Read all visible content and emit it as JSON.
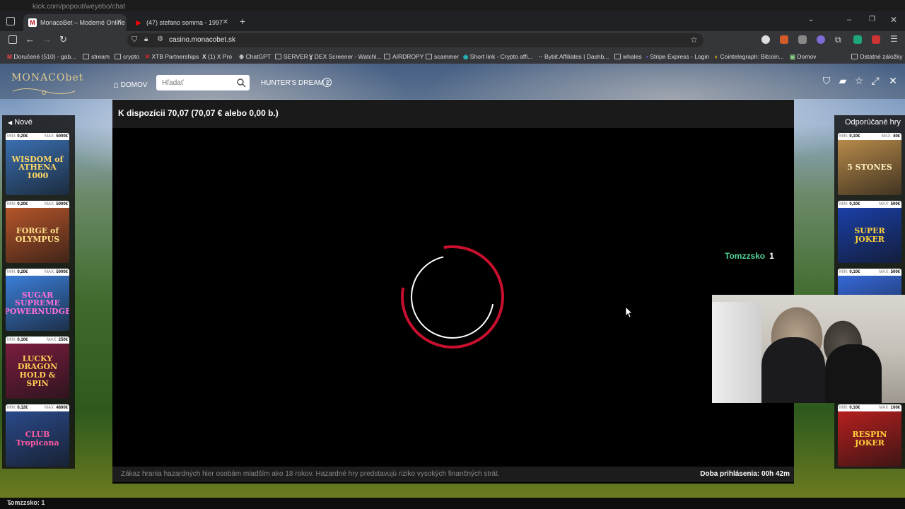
{
  "browser": {
    "ghost_url": "kick.com/popout/weyebo/chat",
    "tabs": [
      {
        "label": "MonacoBet – Moderné Online k",
        "favicon": "M",
        "favicon_color": "#c4161c",
        "active": true
      },
      {
        "label": "(47) stefano somma - 1997",
        "favicon": "▶",
        "favicon_color": "#ff0000",
        "active": false
      }
    ],
    "new_tab": "+",
    "url": "casino.monacobet.sk",
    "bookmarks": [
      "Doručené (510) - gab...",
      "stream",
      "crypto",
      "XTB Partnerships",
      "(1) X Pro",
      "ChatGPT",
      "SERVER",
      "DEX Screener - Watchl...",
      "AIRDROPY",
      "scammer",
      "Short link - Crypto affi...",
      "Bybit Affiliates | Dashb...",
      "whales",
      "Stripe Express - Login",
      "Cointelegraph: Bitcoin...",
      "Domov",
      "Ostatné záložky"
    ]
  },
  "site": {
    "logo_main": "MONACObet",
    "logo_sub": "",
    "nav_home": "DOMOV",
    "search_placeholder": "Hľadať",
    "game_title": "HUNTER'S DREAM 2",
    "balance": "K dispozícii 70,07 (70,07 € alebo 0,00 b.)",
    "warning": "Zákaz hrania hazardných hier osobám mladším ako 18 rokov. Hazardné hry predstavujú riziko vysokých finančných strát.",
    "login_time": "Doba prihlásenia: 00h 42m",
    "spinner_color": "#c8102e"
  },
  "overlay": {
    "viewer_name": "Tomzzsko",
    "viewer_count": "1",
    "status_text": "Tomzzsko: 1"
  },
  "left_panel": {
    "title": "Nové",
    "games": [
      {
        "min": "0,20€",
        "max": "5000€",
        "name": "WISDOM of ATHENA 1000",
        "bg": "#3a6fb0",
        "fg": "#ffd866"
      },
      {
        "min": "0,20€",
        "max": "5000€",
        "name": "FORGE of OLYMPUS",
        "bg": "#b5552a",
        "fg": "#ffe08a"
      },
      {
        "min": "0,20€",
        "max": "5000€",
        "name": "SUGAR SUPREME POWERNUDGE",
        "bg": "#3b7ed8",
        "fg": "#ff6fd6"
      },
      {
        "min": "0,10€",
        "max": "250€",
        "name": "LUCKY DRAGON HOLD & SPIN",
        "bg": "#7a1d3f",
        "fg": "#ffcc55"
      },
      {
        "min": "0,12€",
        "max": "4800€",
        "name": "CLUB Tropicana",
        "bg": "#2a4a8a",
        "fg": "#ff5aa0"
      }
    ]
  },
  "right_panel": {
    "title": "Odporúčané hry",
    "games": [
      {
        "min": "0,10€",
        "max": "40€",
        "name": "5 STONES",
        "bg": "#b78a4a",
        "fg": "#fff2c0"
      },
      {
        "min": "0,10€",
        "max": "500€",
        "name": "SUPER JOKER",
        "bg": "#1a3fa8",
        "fg": "#ffd23a"
      },
      {
        "min": "0,10€",
        "max": "500€",
        "name": "",
        "bg": "#3568d8",
        "fg": "#ffffff"
      },
      {
        "min": "",
        "max": "",
        "name": "",
        "bg": "#222222",
        "fg": "#ffffff"
      },
      {
        "min": "0,10€",
        "max": "100€",
        "name": "RESPIN JOKER",
        "bg": "#b51f1f",
        "fg": "#ffd23a"
      }
    ]
  }
}
